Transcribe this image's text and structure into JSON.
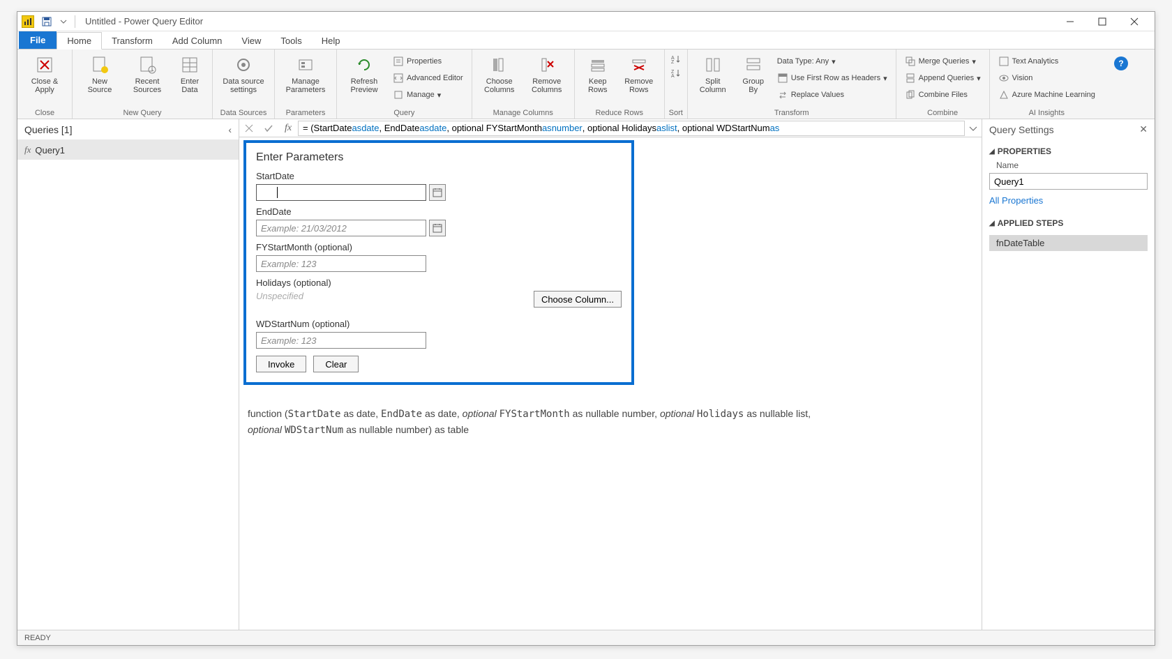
{
  "window": {
    "title": "Untitled - Power Query Editor"
  },
  "tabs": {
    "file": "File",
    "home": "Home",
    "transform": "Transform",
    "add_column": "Add Column",
    "view": "View",
    "tools": "Tools",
    "help": "Help"
  },
  "ribbon": {
    "close": {
      "label": "Close &\nApply",
      "group": "Close"
    },
    "new_query": {
      "new_source": "New\nSource",
      "recent_sources": "Recent\nSources",
      "enter_data": "Enter\nData",
      "group": "New Query"
    },
    "data_sources": {
      "settings": "Data source\nsettings",
      "group": "Data Sources"
    },
    "parameters": {
      "manage": "Manage\nParameters",
      "group": "Parameters"
    },
    "query": {
      "refresh": "Refresh\nPreview",
      "properties": "Properties",
      "adv_editor": "Advanced Editor",
      "manage": "Manage",
      "group": "Query"
    },
    "manage_columns": {
      "choose": "Choose\nColumns",
      "remove": "Remove\nColumns",
      "group": "Manage Columns"
    },
    "reduce_rows": {
      "keep": "Keep\nRows",
      "remove": "Remove\nRows",
      "group": "Reduce Rows"
    },
    "sort": {
      "group": "Sort"
    },
    "transform_grp": {
      "split": "Split\nColumn",
      "group_by": "Group\nBy",
      "data_type": "Data Type: Any",
      "first_row": "Use First Row as Headers",
      "replace": "Replace Values",
      "group": "Transform"
    },
    "combine": {
      "merge": "Merge Queries",
      "append": "Append Queries",
      "files": "Combine Files",
      "group": "Combine"
    },
    "ai": {
      "text": "Text Analytics",
      "vision": "Vision",
      "azure": "Azure Machine Learning",
      "group": "AI Insights"
    }
  },
  "formula": {
    "prefix": "= (StartDate ",
    "as1": "as",
    "t1": " date",
    "c1": ", EndDate ",
    "as2": "as",
    "t2": " date",
    "c2": ", optional FYStartMonth ",
    "as3": "as",
    "t3": " number",
    "c3": ", optional Holidays ",
    "as4": "as",
    "t4": " list",
    "c4": ", optional WDStartNum ",
    "as5": "as"
  },
  "queries": {
    "header": "Queries [1]",
    "item1": "Query1"
  },
  "params": {
    "title": "Enter Parameters",
    "start_label": "StartDate",
    "end_label": "EndDate",
    "end_placeholder": "Example: 21/03/2012",
    "fy_label": "FYStartMonth (optional)",
    "fy_placeholder": "Example: 123",
    "hol_label": "Holidays (optional)",
    "unspecified": "Unspecified",
    "choose_col": "Choose Column...",
    "wd_label": "WDStartNum (optional)",
    "wd_placeholder": "Example: 123",
    "invoke": "Invoke",
    "clear": "Clear"
  },
  "signature": {
    "fn": "function (",
    "p1": "StartDate",
    "p1t": " as date, ",
    "p2": "EndDate",
    "p2t": " as date, ",
    "opt1": "optional ",
    "p3": "FYStartMonth",
    "p3t": " as nullable number, ",
    "opt2": "optional ",
    "p4": "Holidays",
    "p4t": " as nullable list, ",
    "opt3": "optional ",
    "p5": "WDStartNum",
    "p5t": " as nullable number) as table"
  },
  "settings": {
    "header": "Query Settings",
    "properties": "PROPERTIES",
    "name_label": "Name",
    "name_value": "Query1",
    "all_props": "All Properties",
    "applied": "APPLIED STEPS",
    "step1": "fnDateTable"
  },
  "status": "READY"
}
